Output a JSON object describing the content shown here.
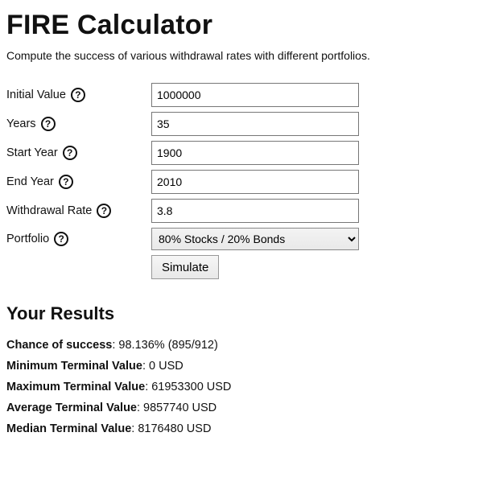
{
  "header": {
    "title": "FIRE Calculator",
    "intro": "Compute the success of various withdrawal rates with different portfolios."
  },
  "form": {
    "initial_value": {
      "label": "Initial Value",
      "value": "1000000"
    },
    "years": {
      "label": "Years",
      "value": "35"
    },
    "start_year": {
      "label": "Start Year",
      "value": "1900"
    },
    "end_year": {
      "label": "End Year",
      "value": "2010"
    },
    "withdrawal_rate": {
      "label": "Withdrawal Rate",
      "value": "3.8"
    },
    "portfolio": {
      "label": "Portfolio",
      "selected": "80% Stocks / 20% Bonds"
    },
    "simulate_label": "Simulate"
  },
  "help_glyph": "?",
  "results": {
    "heading": "Your Results",
    "chance_label": "Chance of success",
    "chance_value": ": 98.136% (895/912)",
    "min_label": "Minimum Terminal Value",
    "min_value": ": 0 USD",
    "max_label": "Maximum Terminal Value",
    "max_value": ": 61953300 USD",
    "avg_label": "Average Terminal Value",
    "avg_value": ": 9857740 USD",
    "med_label": "Median Terminal Value",
    "med_value": ": 8176480 USD"
  }
}
